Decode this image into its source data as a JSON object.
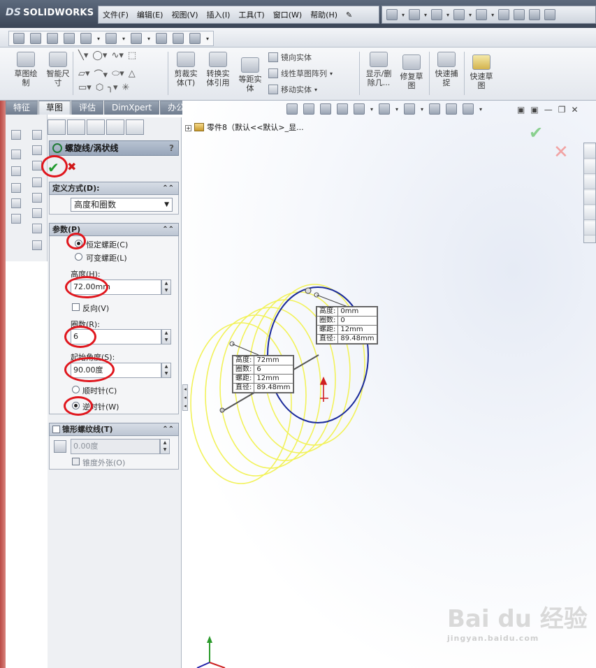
{
  "app": {
    "logo_text": "SOLIDWORKS",
    "logo_mark": "DS"
  },
  "menu": [
    "文件(F)",
    "编辑(E)",
    "视图(V)",
    "插入(I)",
    "工具(T)",
    "窗口(W)",
    "帮助(H)"
  ],
  "commands": {
    "sketch": "草图绘\n制",
    "smart_dim": "智能尺\n寸",
    "trim": "剪裁实\n体(T)",
    "convert": "转换实\n体引用",
    "offset": "等距实\n体",
    "mirror": "镜向实体",
    "linear_pattern": "线性草图阵列",
    "move": "移动实体",
    "show_hide": "显示/删\n除几...",
    "repair": "修复草\n图",
    "quick_snap": "快速捕\n捉",
    "rapid_sketch": "快速草\n图"
  },
  "tabs": [
    "特征",
    "草图",
    "评估",
    "DimXpert",
    "办公室产品"
  ],
  "active_tab": "草图",
  "property_manager": {
    "title": "螺旋线/涡状线",
    "help": "?",
    "definition": {
      "header": "定义方式(D):",
      "value": "高度和圈数"
    },
    "parameters": {
      "header": "参数(P)",
      "constant_pitch": "恒定螺距(C)",
      "variable_pitch": "可变螺距(L)",
      "height_label": "高度(H):",
      "height_value": "72.00mm",
      "reverse_label": "反向(V)",
      "revolutions_label": "圈数(R):",
      "revolutions_value": "6",
      "start_angle_label": "起始角度(S):",
      "start_angle_value": "90.00度",
      "clockwise": "顺时针(C)",
      "counterclockwise": "逆时针(W)"
    },
    "taper": {
      "header": "锥形螺纹线(T)",
      "angle_value": "0.00度",
      "outward": "锥度外张(O)"
    }
  },
  "tree": {
    "item": "零件8（默认<<默认>_显..."
  },
  "callout_start": [
    [
      "高度:",
      "0mm"
    ],
    [
      "圈数:",
      "0"
    ],
    [
      "螺距:",
      "12mm"
    ],
    [
      "直径:",
      "89.48mm"
    ]
  ],
  "callout_end": [
    [
      "高度:",
      "72mm"
    ],
    [
      "圈数:",
      "6"
    ],
    [
      "螺距:",
      "12mm"
    ],
    [
      "直径:",
      "89.48mm"
    ]
  ],
  "colors": {
    "helix_preview": "#f2f25a",
    "helix_base": "#1a2a9a",
    "annotation_red": "#e0161d"
  },
  "watermark": {
    "main": "Bai du 经验",
    "url": "jingyan.baidu.com"
  }
}
